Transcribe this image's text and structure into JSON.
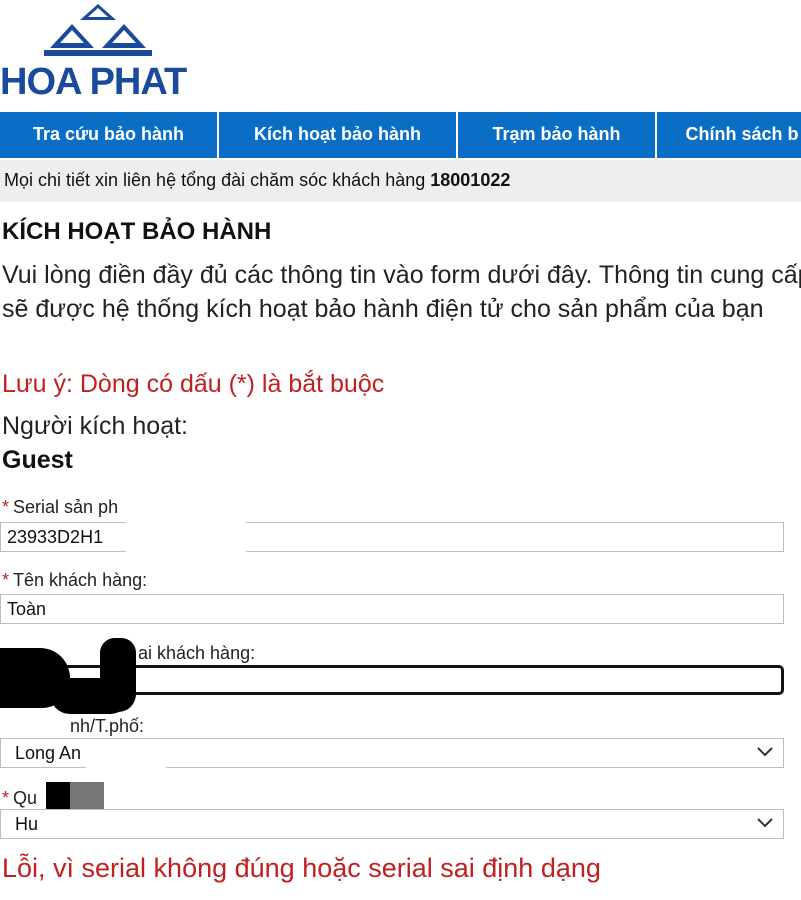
{
  "brand": {
    "name": "HOA PHAT",
    "logo_icon": "triple-roof-logo",
    "color": "#1a4a9c"
  },
  "nav": {
    "color": "#0a6ec6",
    "items": [
      {
        "label": "Tra cứu bảo hành"
      },
      {
        "label": "Kích hoạt bảo hành"
      },
      {
        "label": "Trạm bảo hành"
      },
      {
        "label": "Chính sách b"
      }
    ]
  },
  "hotline": {
    "text": "Mọi chi tiết xin liên hệ tổng đài chăm sóc khách hàng",
    "number": "18001022"
  },
  "page": {
    "title": "KÍCH HOẠT BẢO HÀNH",
    "intro": "Vui lòng điền đầy đủ các thông tin vào form dưới đây. Thông tin cung cấp sẽ được hệ thống kích hoạt bảo hành điện tử cho sản phẩm của bạn",
    "note": "Lưu ý: Dòng có dấu (*) là bắt buộc",
    "activator_label": "Người kích hoạt:",
    "activator_name": "Guest"
  },
  "form": {
    "required_mark": "*",
    "serial": {
      "label": "Serial sản ph",
      "value": "23933D2H1"
    },
    "customer_name": {
      "label": "Tên khách hàng:",
      "value": "Toàn"
    },
    "phone": {
      "label": "ai khách hàng:",
      "value": ""
    },
    "province": {
      "label": "nh/T.phố:",
      "value": "Long An"
    },
    "district": {
      "label": "Qu",
      "value": "Hu"
    }
  },
  "error": {
    "message": "Lỗi, vì serial không đúng hoặc serial sai định dạng",
    "color": "#c0201f"
  }
}
